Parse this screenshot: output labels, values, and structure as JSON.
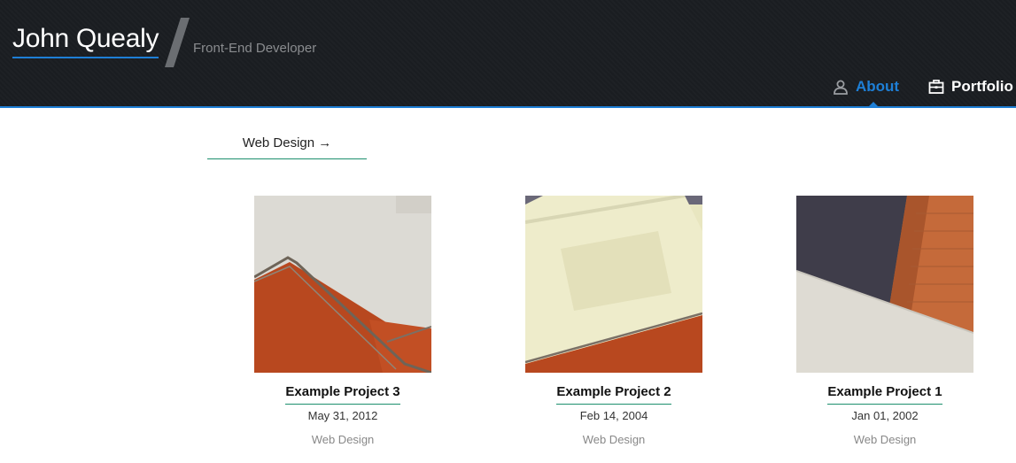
{
  "header": {
    "site_title": "John Quealy",
    "tagline": "Front-End Developer",
    "nav": [
      {
        "label": "About",
        "icon": "user-icon",
        "active": true
      },
      {
        "label": "Portfolio",
        "icon": "briefcase-icon",
        "active": false
      }
    ],
    "accent_color": "#1e7fd6"
  },
  "category_link": "Web Design →",
  "projects": [
    {
      "title": "Example Project 3",
      "date": "May 31, 2012",
      "category": "Web Design",
      "image": "stairwell-photo"
    },
    {
      "title": "Example Project 2",
      "date": "Feb 14, 2004",
      "category": "Web Design",
      "image": "skylight-photo"
    },
    {
      "title": "Example Project 1",
      "date": "Jan 01, 2002",
      "category": "Web Design",
      "image": "brick-wall-photo"
    }
  ]
}
